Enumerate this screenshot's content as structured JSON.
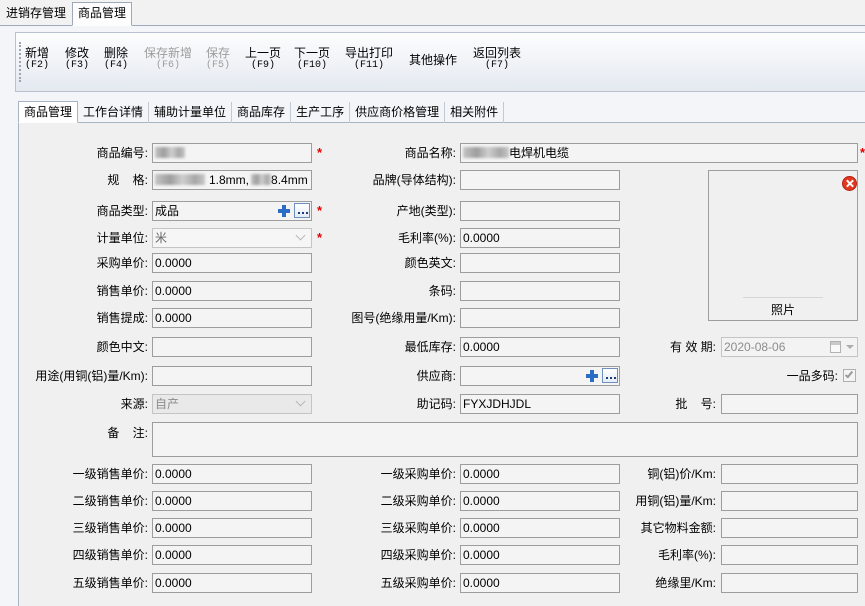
{
  "window_tabs": {
    "inventory": "进销存管理",
    "product": "商品管理"
  },
  "toolbar": {
    "add": {
      "label": "新增",
      "key": "(F2)",
      "enabled": true
    },
    "edit": {
      "label": "修改",
      "key": "(F3)",
      "enabled": true
    },
    "delete": {
      "label": "删除",
      "key": "(F4)",
      "enabled": true
    },
    "save_new": {
      "label": "保存新增",
      "key": "(F6)",
      "enabled": false
    },
    "save": {
      "label": "保存",
      "key": "(F5)",
      "enabled": false
    },
    "prev": {
      "label": "上一页",
      "key": "(F9)",
      "enabled": true
    },
    "next": {
      "label": "下一页",
      "key": "(F10)",
      "enabled": true
    },
    "export": {
      "label": "导出打印",
      "key": "(F11)",
      "enabled": true
    },
    "other": {
      "label": "其他操作",
      "enabled": true
    },
    "back": {
      "label": "返回列表",
      "key": "(F7)",
      "enabled": true
    }
  },
  "sub_tabs": [
    "商品管理",
    "工作台详情",
    "辅助计量单位",
    "商品库存",
    "生产工序",
    "供应商价格管理",
    "相关附件"
  ],
  "required_mark": "*",
  "form": {
    "product_code": {
      "label": "商品编号:"
    },
    "product_name": {
      "label": "商品名称:",
      "value": "电焊机电缆"
    },
    "spec": {
      "label": "规    格:",
      "value_part1": "1.8mm,",
      "value_part2": "8.4mm"
    },
    "brand": {
      "label": "品牌(导体结构):",
      "value": ""
    },
    "product_type": {
      "label": "商品类型:",
      "value": "成品"
    },
    "origin": {
      "label": "产地(类型):",
      "value": ""
    },
    "unit": {
      "label": "计量单位:",
      "value": "米"
    },
    "gross_margin": {
      "label": "毛利率(%):",
      "value": "0.0000"
    },
    "purchase_price": {
      "label": "采购单价:",
      "value": "0.0000"
    },
    "color_en": {
      "label": "颜色英文:",
      "value": ""
    },
    "sale_price": {
      "label": "销售单价:",
      "value": "0.0000"
    },
    "barcode": {
      "label": "条码:",
      "value": ""
    },
    "commission": {
      "label": "销售提成:",
      "value": "0.0000"
    },
    "drawing_no": {
      "label": "图号(绝缘用量/Km):",
      "value": ""
    },
    "color_cn": {
      "label": "颜色中文:",
      "value": ""
    },
    "min_stock": {
      "label": "最低库存:",
      "value": "0.0000"
    },
    "expiry_date": {
      "label": "有 效 期:",
      "value": "2020-08-06"
    },
    "usage": {
      "label": "用途(用铜(铝)量/Km):",
      "value": ""
    },
    "supplier": {
      "label": "供应商:",
      "value": ""
    },
    "multi_code": {
      "label": "一品多码:",
      "checked": true
    },
    "source": {
      "label": "来源:",
      "value": "自产"
    },
    "mnemonic": {
      "label": "助记码:",
      "value": "FYXJDHJDL"
    },
    "batch_no": {
      "label": "批    号:",
      "value": ""
    },
    "remark": {
      "label": "备    注:",
      "value": ""
    },
    "sale_price_l1": {
      "label": "一级销售单价:",
      "value": "0.0000"
    },
    "sale_price_l2": {
      "label": "二级销售单价:",
      "value": "0.0000"
    },
    "sale_price_l3": {
      "label": "三级销售单价:",
      "value": "0.0000"
    },
    "sale_price_l4": {
      "label": "四级销售单价:",
      "value": "0.0000"
    },
    "sale_price_l5": {
      "label": "五级销售单价:",
      "value": "0.0000"
    },
    "purchase_price_l1": {
      "label": "一级采购单价:",
      "value": "0.0000"
    },
    "purchase_price_l2": {
      "label": "二级采购单价:",
      "value": "0.0000"
    },
    "purchase_price_l3": {
      "label": "三级采购单价:",
      "value": "0.0000"
    },
    "purchase_price_l4": {
      "label": "四级采购单价:",
      "value": "0.0000"
    },
    "purchase_price_l5": {
      "label": "五级采购单价:",
      "value": "0.0000"
    },
    "copper_price_per_km": {
      "label": "铜(铝)价/Km:",
      "value": ""
    },
    "copper_qty_per_km": {
      "label": "用铜(铝)量/Km:",
      "value": ""
    },
    "other_material_amount": {
      "label": "其它物料金额:",
      "value": ""
    },
    "gross_margin_2": {
      "label": "毛利率(%):",
      "value": ""
    },
    "insulation_per_km": {
      "label": "绝缘里/Km:",
      "value": ""
    }
  },
  "photo": {
    "label": "照片"
  },
  "icons": {
    "add_button": "plus-icon",
    "browse_button": "ellipsis-icon",
    "dropdown": "chevron-down-icon",
    "date_picker": "calendar-icon",
    "photo_remove": "close-icon",
    "checkbox_mark": "check-icon"
  },
  "colors": {
    "required": "#e60000",
    "photo_remove": "#e2361f",
    "add_button": "#2b6cc4",
    "disabled_text": "#9c9c9c"
  }
}
